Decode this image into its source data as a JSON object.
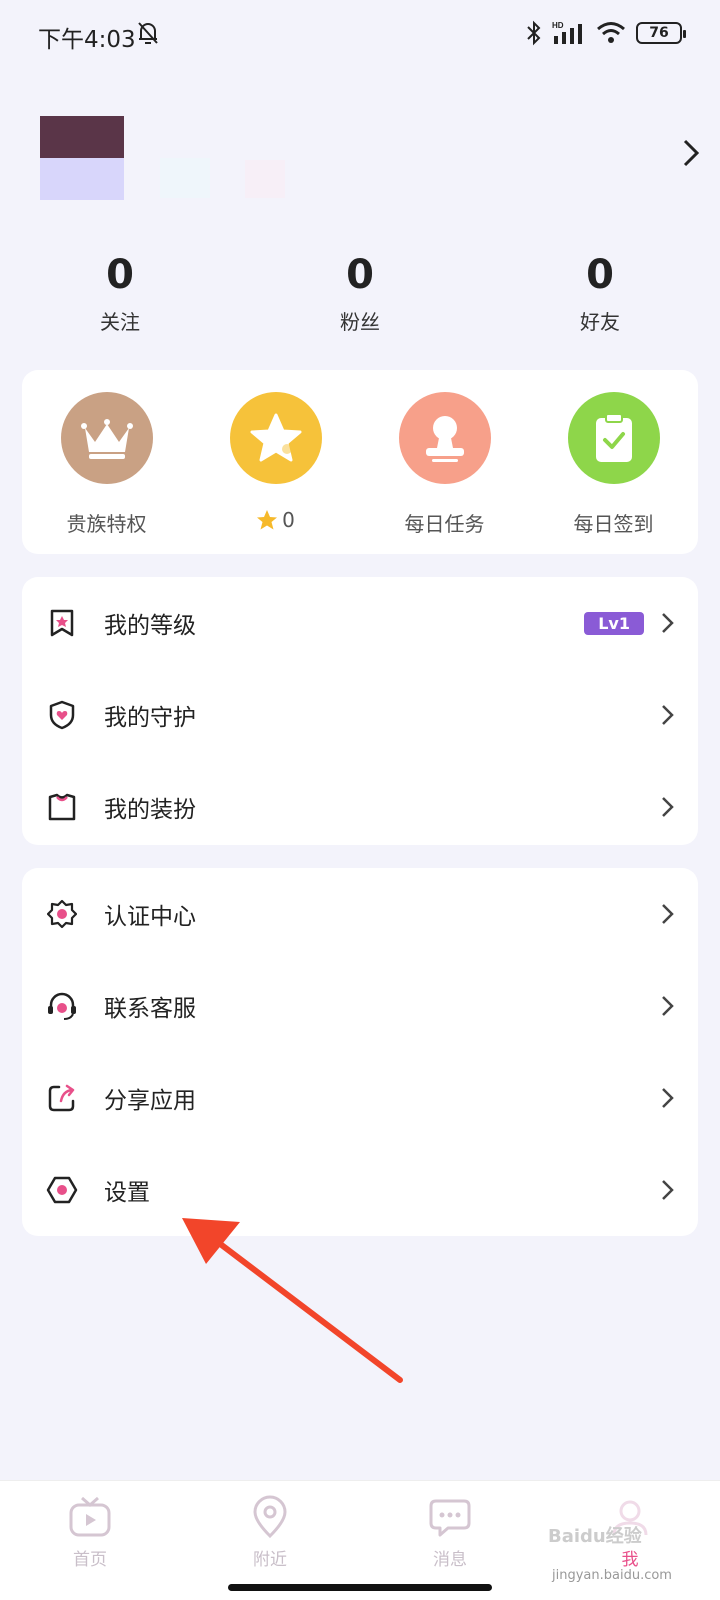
{
  "status": {
    "time": "下午4:03",
    "battery": "76"
  },
  "stats": [
    {
      "value": "0",
      "label": "关注"
    },
    {
      "value": "0",
      "label": "粉丝"
    },
    {
      "value": "0",
      "label": "好友"
    }
  ],
  "quick": [
    {
      "label": "贵族特权",
      "icon": "crown-icon",
      "color": "#c9a184"
    },
    {
      "label": "0",
      "icon": "star-icon",
      "color": "#f6c23a"
    },
    {
      "label": "每日任务",
      "icon": "task-stamp-icon",
      "color": "#f7a08a"
    },
    {
      "label": "每日签到",
      "icon": "checkin-clipboard-icon",
      "color": "#8ed64a"
    }
  ],
  "menu1": [
    {
      "label": "我的等级",
      "icon": "level-bookmark-icon",
      "badge": "Lv1"
    },
    {
      "label": "我的守护",
      "icon": "shield-heart-icon"
    },
    {
      "label": "我的装扮",
      "icon": "outfit-shirt-icon"
    }
  ],
  "menu2": [
    {
      "label": "认证中心",
      "icon": "certification-icon"
    },
    {
      "label": "联系客服",
      "icon": "customer-service-icon"
    },
    {
      "label": "分享应用",
      "icon": "share-icon"
    },
    {
      "label": "设置",
      "icon": "settings-icon"
    }
  ],
  "nav": [
    {
      "label": "首页",
      "icon": "tv-home-icon"
    },
    {
      "label": "附近",
      "icon": "location-pin-icon"
    },
    {
      "label": "消息",
      "icon": "message-bubble-icon"
    },
    {
      "label": "我",
      "icon": "profile-icon"
    }
  ],
  "watermark": {
    "text": "Baidu经验",
    "url": "jingyan.baidu.com"
  },
  "colors": {
    "accent": "#e8508a",
    "badge": "#8a5bd6",
    "arrow": "#f2452a"
  }
}
